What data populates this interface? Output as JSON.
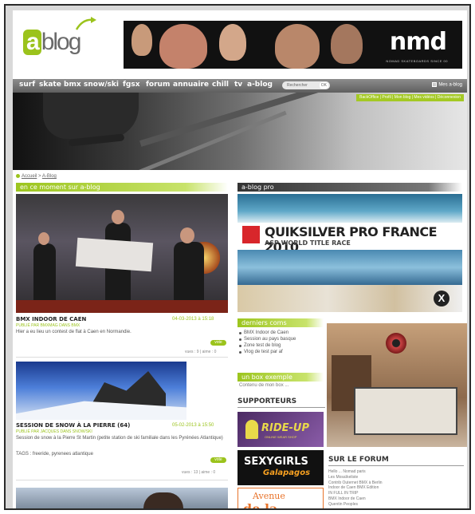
{
  "header": {
    "logo_a": "a",
    "logo_blog": "blog",
    "banner_brand": "nmd",
    "banner_sub": "NOMAD SKATEBOARDS SINCE 00"
  },
  "nav": {
    "items": [
      "surf",
      "skate",
      "bmx",
      "snow/ski",
      "fgsx",
      "forum",
      "annuaire",
      "chill",
      "tv",
      "a-blog"
    ],
    "search_placeholder": "Rechercher",
    "search_ok": "OK",
    "right_label": "Mes a-blog"
  },
  "hero": {
    "links": "BackOffice | Profil | Mon blog | Mes vidéos | Déconnexion"
  },
  "breadcrumb": {
    "home": "Accueil",
    "sep": " > ",
    "current": "A-Blog"
  },
  "left": {
    "section_title": "en ce moment sur a-blog",
    "article1": {
      "title": "BMX INDOOR DE CAEN",
      "date": "04-03-2013 à 15:18",
      "by": "PUBLIÉ PAR BMXMAG DANS BMX",
      "text": "Hier a eu lieu un contest de flat à Caen en Normandie.",
      "vote": "vote",
      "meta": "vues : 9 | aime : 0"
    },
    "article2": {
      "title": "SESSION DE SNOW À LA PIERRE (64)",
      "date": "05-02-2013 à 15:50",
      "by": "PUBLIÉ PAR JACQUES DANS SNOW/SKI",
      "text": "Session de snow à la Pierre St Martin (petite station de ski familiale dans les Pyrénées Atlantique)",
      "tags": "TAGS : freeride, pyrenees atlantique",
      "vote": "vote",
      "meta": "vues : 13 | aime : 0"
    }
  },
  "right": {
    "section_title": "a-blog pro",
    "quik_title": "QUIKSILVER PRO FRANCE 2010",
    "quik_sub": "ASP WORLD TITLE RACE",
    "x_badge": "X",
    "com_title": "derniers coms",
    "com_items": [
      "BMX Indoor de Caen",
      "Session au pays basque",
      "Zone test de blog",
      "Vlog de test par af"
    ],
    "box_title": "un box exemple",
    "box_text": "Contenu de mon box ...",
    "supporters": "SUPPORTEURS",
    "rideup": "RIDE-UP",
    "rideup_sub": "ONLINE WEAR SHOP",
    "sexy_l1": "SEXYGIRLS",
    "sexy_l2": "Galapagos",
    "avenue_l1": "Avenue",
    "avenue_l2": "de la Glisse",
    "forum_title": "SUR LE FORUM",
    "forum_items": [
      "Hello ... Nomad paris",
      "Les Mosaïkeliste",
      "Contrib Outernet BMX à Berlin",
      "Indoor de Caen BMX Edition",
      "IN FULL IN TRIP",
      "BMX Indoor de Caen",
      "Quentin Peoples"
    ]
  },
  "colors": {
    "accent_green": "#9bc31c",
    "nav_grey": "#6f6f6f"
  }
}
